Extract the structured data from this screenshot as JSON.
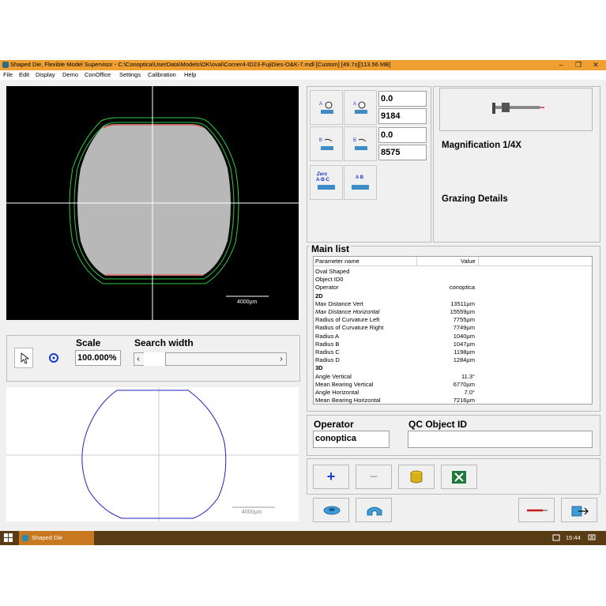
{
  "window": {
    "title": "Shaped Die, Flexible Model Supervisor - C:\\Conoptica\\UserData\\Models\\OK\\oval\\Corner4-ID23-FujiDies-O&K-7.mdl [Custom]   [49.7s][113.56 MB]",
    "controls": [
      "–",
      "❐",
      "✕"
    ]
  },
  "menu": [
    "File",
    "Edit",
    "Display",
    "Demo",
    "ConOffice",
    "Settings",
    "Calibration",
    "Help"
  ],
  "camera_view": {
    "scale_bar": "4000µm"
  },
  "scale_panel": {
    "scale_label": "Scale",
    "scale_value": "100.000%",
    "search_label": "Search width",
    "scroll_left": "‹",
    "scroll_right": "›"
  },
  "profile_view": {
    "scale_bar": "4000µm"
  },
  "readouts": [
    "0.0",
    "9184",
    "0.0",
    "8575"
  ],
  "tool_buttons": {
    "zero_label": "Zero",
    "zero_sub": "A-B-C",
    "ab_label": "A B"
  },
  "info_panel": {
    "magnification": "Magnification 1/4X",
    "grazing": "Grazing Details"
  },
  "main_list": {
    "title": "Main list",
    "col_param": "Parameter name",
    "col_value": "Value",
    "rows": [
      {
        "name": "Oval Shaped",
        "value": "",
        "style": "normal"
      },
      {
        "name": "Object ID0",
        "value": "",
        "style": "normal"
      },
      {
        "name": "Operator",
        "value": "conoptica",
        "style": "normal"
      },
      {
        "name": "2D",
        "value": "",
        "style": "bold"
      },
      {
        "name": "Max Distance Vert",
        "value": "13511µm",
        "style": "normal"
      },
      {
        "name": "Max Distance Horizontal",
        "value": "15559µm",
        "style": "italic"
      },
      {
        "name": "Radius of Curvature Left",
        "value": "7755µm",
        "style": "normal"
      },
      {
        "name": "Radius of Curvature Right",
        "value": "7749µm",
        "style": "normal"
      },
      {
        "name": "Radius A",
        "value": "1040µm",
        "style": "normal"
      },
      {
        "name": "Radius B",
        "value": "1047µm",
        "style": "normal"
      },
      {
        "name": "Radius C",
        "value": "1198µm",
        "style": "normal"
      },
      {
        "name": "Radius D",
        "value": "1284µm",
        "style": "normal"
      },
      {
        "name": "3D",
        "value": "",
        "style": "bold"
      },
      {
        "name": "Angle Vertical",
        "value": "11.3°",
        "style": "normal"
      },
      {
        "name": "Mean Bearing Vertical",
        "value": "6770µm",
        "style": "normal"
      },
      {
        "name": "Angle Horizontal",
        "value": "7.0°",
        "style": "normal"
      },
      {
        "name": "Mean Bearing Horizontal",
        "value": "7216µm",
        "style": "normal"
      }
    ]
  },
  "operator_panel": {
    "operator_label": "Operator",
    "operator_value": "conoptica",
    "qc_label": "QC Object ID",
    "qc_value": ""
  },
  "action_buttons": {
    "add": "+",
    "remove": "−"
  },
  "taskbar": {
    "app_label": "Shaped Die",
    "time": "15:44"
  },
  "colors": {
    "titlebar": "#f0a030",
    "contour_green": "#2ecc40",
    "contour_red": "#e83030",
    "profile_blue": "#2020c0",
    "taskbar": "#5a3c14",
    "add_blue": "#1a3cc8"
  }
}
